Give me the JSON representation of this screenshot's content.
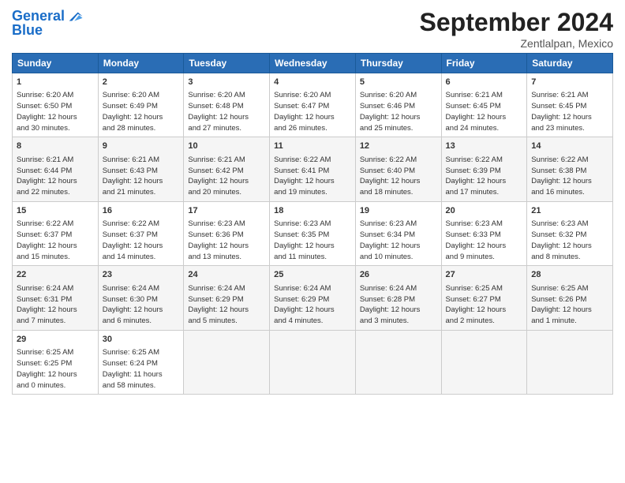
{
  "header": {
    "logo_line1": "General",
    "logo_line2": "Blue",
    "month": "September 2024",
    "location": "Zentlalpan, Mexico"
  },
  "days_of_week": [
    "Sunday",
    "Monday",
    "Tuesday",
    "Wednesday",
    "Thursday",
    "Friday",
    "Saturday"
  ],
  "weeks": [
    [
      {
        "day": "1",
        "info": "Sunrise: 6:20 AM\nSunset: 6:50 PM\nDaylight: 12 hours\nand 30 minutes."
      },
      {
        "day": "2",
        "info": "Sunrise: 6:20 AM\nSunset: 6:49 PM\nDaylight: 12 hours\nand 28 minutes."
      },
      {
        "day": "3",
        "info": "Sunrise: 6:20 AM\nSunset: 6:48 PM\nDaylight: 12 hours\nand 27 minutes."
      },
      {
        "day": "4",
        "info": "Sunrise: 6:20 AM\nSunset: 6:47 PM\nDaylight: 12 hours\nand 26 minutes."
      },
      {
        "day": "5",
        "info": "Sunrise: 6:20 AM\nSunset: 6:46 PM\nDaylight: 12 hours\nand 25 minutes."
      },
      {
        "day": "6",
        "info": "Sunrise: 6:21 AM\nSunset: 6:45 PM\nDaylight: 12 hours\nand 24 minutes."
      },
      {
        "day": "7",
        "info": "Sunrise: 6:21 AM\nSunset: 6:45 PM\nDaylight: 12 hours\nand 23 minutes."
      }
    ],
    [
      {
        "day": "8",
        "info": "Sunrise: 6:21 AM\nSunset: 6:44 PM\nDaylight: 12 hours\nand 22 minutes."
      },
      {
        "day": "9",
        "info": "Sunrise: 6:21 AM\nSunset: 6:43 PM\nDaylight: 12 hours\nand 21 minutes."
      },
      {
        "day": "10",
        "info": "Sunrise: 6:21 AM\nSunset: 6:42 PM\nDaylight: 12 hours\nand 20 minutes."
      },
      {
        "day": "11",
        "info": "Sunrise: 6:22 AM\nSunset: 6:41 PM\nDaylight: 12 hours\nand 19 minutes."
      },
      {
        "day": "12",
        "info": "Sunrise: 6:22 AM\nSunset: 6:40 PM\nDaylight: 12 hours\nand 18 minutes."
      },
      {
        "day": "13",
        "info": "Sunrise: 6:22 AM\nSunset: 6:39 PM\nDaylight: 12 hours\nand 17 minutes."
      },
      {
        "day": "14",
        "info": "Sunrise: 6:22 AM\nSunset: 6:38 PM\nDaylight: 12 hours\nand 16 minutes."
      }
    ],
    [
      {
        "day": "15",
        "info": "Sunrise: 6:22 AM\nSunset: 6:37 PM\nDaylight: 12 hours\nand 15 minutes."
      },
      {
        "day": "16",
        "info": "Sunrise: 6:22 AM\nSunset: 6:37 PM\nDaylight: 12 hours\nand 14 minutes."
      },
      {
        "day": "17",
        "info": "Sunrise: 6:23 AM\nSunset: 6:36 PM\nDaylight: 12 hours\nand 13 minutes."
      },
      {
        "day": "18",
        "info": "Sunrise: 6:23 AM\nSunset: 6:35 PM\nDaylight: 12 hours\nand 11 minutes."
      },
      {
        "day": "19",
        "info": "Sunrise: 6:23 AM\nSunset: 6:34 PM\nDaylight: 12 hours\nand 10 minutes."
      },
      {
        "day": "20",
        "info": "Sunrise: 6:23 AM\nSunset: 6:33 PM\nDaylight: 12 hours\nand 9 minutes."
      },
      {
        "day": "21",
        "info": "Sunrise: 6:23 AM\nSunset: 6:32 PM\nDaylight: 12 hours\nand 8 minutes."
      }
    ],
    [
      {
        "day": "22",
        "info": "Sunrise: 6:24 AM\nSunset: 6:31 PM\nDaylight: 12 hours\nand 7 minutes."
      },
      {
        "day": "23",
        "info": "Sunrise: 6:24 AM\nSunset: 6:30 PM\nDaylight: 12 hours\nand 6 minutes."
      },
      {
        "day": "24",
        "info": "Sunrise: 6:24 AM\nSunset: 6:29 PM\nDaylight: 12 hours\nand 5 minutes."
      },
      {
        "day": "25",
        "info": "Sunrise: 6:24 AM\nSunset: 6:29 PM\nDaylight: 12 hours\nand 4 minutes."
      },
      {
        "day": "26",
        "info": "Sunrise: 6:24 AM\nSunset: 6:28 PM\nDaylight: 12 hours\nand 3 minutes."
      },
      {
        "day": "27",
        "info": "Sunrise: 6:25 AM\nSunset: 6:27 PM\nDaylight: 12 hours\nand 2 minutes."
      },
      {
        "day": "28",
        "info": "Sunrise: 6:25 AM\nSunset: 6:26 PM\nDaylight: 12 hours\nand 1 minute."
      }
    ],
    [
      {
        "day": "29",
        "info": "Sunrise: 6:25 AM\nSunset: 6:25 PM\nDaylight: 12 hours\nand 0 minutes."
      },
      {
        "day": "30",
        "info": "Sunrise: 6:25 AM\nSunset: 6:24 PM\nDaylight: 11 hours\nand 58 minutes."
      },
      {
        "day": "",
        "info": ""
      },
      {
        "day": "",
        "info": ""
      },
      {
        "day": "",
        "info": ""
      },
      {
        "day": "",
        "info": ""
      },
      {
        "day": "",
        "info": ""
      }
    ]
  ]
}
